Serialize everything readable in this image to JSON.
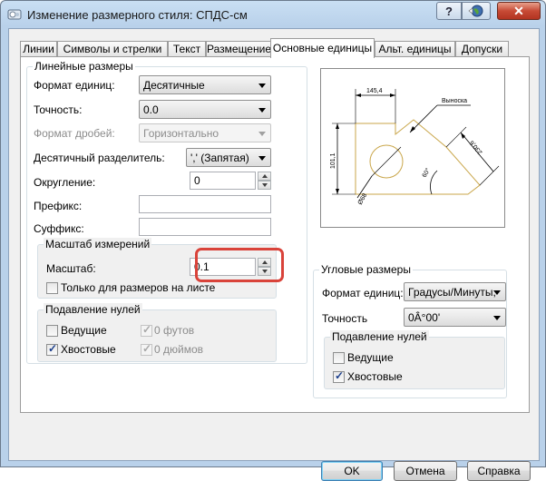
{
  "window": {
    "title": "Изменение размерного стиля: СПДС-см",
    "help_label": "?",
    "close_label": "✕"
  },
  "tabs": [
    {
      "label": "Линии"
    },
    {
      "label": "Символы и стрелки"
    },
    {
      "label": "Текст"
    },
    {
      "label": "Размещение"
    },
    {
      "label": "Основные единицы"
    },
    {
      "label": "Альт. единицы"
    },
    {
      "label": "Допуски"
    }
  ],
  "linear": {
    "title": "Линейные размеры",
    "unit_format_label": "Формат единиц:",
    "unit_format_value": "Десятичные",
    "precision_label": "Точность:",
    "precision_value": "0.0",
    "fraction_format_label": "Формат дробей:",
    "fraction_format_value": "Горизонтально",
    "decimal_sep_label": "Десятичный разделитель:",
    "decimal_sep_value": "',' (Запятая)",
    "roundoff_label": "Округление:",
    "roundoff_value": "0",
    "prefix_label": "Префикс:",
    "prefix_value": "",
    "suffix_label": "Суффикс:",
    "suffix_value": ""
  },
  "scale": {
    "title": "Масштаб измерений",
    "scale_label": "Масштаб:",
    "scale_value": "0.1",
    "layout_only_label": "Только для размеров на листе",
    "layout_only_checked": false
  },
  "zero_linear": {
    "title": "Подавление нулей",
    "leading_label": "Ведущие",
    "leading_checked": false,
    "trailing_label": "Хвостовые",
    "trailing_checked": true,
    "feet_label": "0 футов",
    "feet_checked": true,
    "inches_label": "0 дюймов",
    "inches_checked": true
  },
  "angular": {
    "title": "Угловые размеры",
    "unit_format_label": "Формат единиц:",
    "unit_format_value": "Градусы/Минуты,",
    "precision_label": "Точность",
    "precision_value": "0Â°00'"
  },
  "zero_angular": {
    "title": "Подавление нулей",
    "leading_label": "Ведущие",
    "leading_checked": false,
    "trailing_label": "Хвостовые",
    "trailing_checked": true
  },
  "preview": {
    "dim_top": "145,4",
    "dim_left": "101,1",
    "dim_diag": "230,6",
    "dim_angle": "60°",
    "dim_dia": "Ø68",
    "leader": "Выноска"
  },
  "buttons": {
    "ok": "OK",
    "cancel": "Отмена",
    "help": "Справка"
  },
  "colors": {
    "highlight": "#d9433a",
    "title_bar": "#b9d1ea",
    "close_button": "#c74b36"
  }
}
